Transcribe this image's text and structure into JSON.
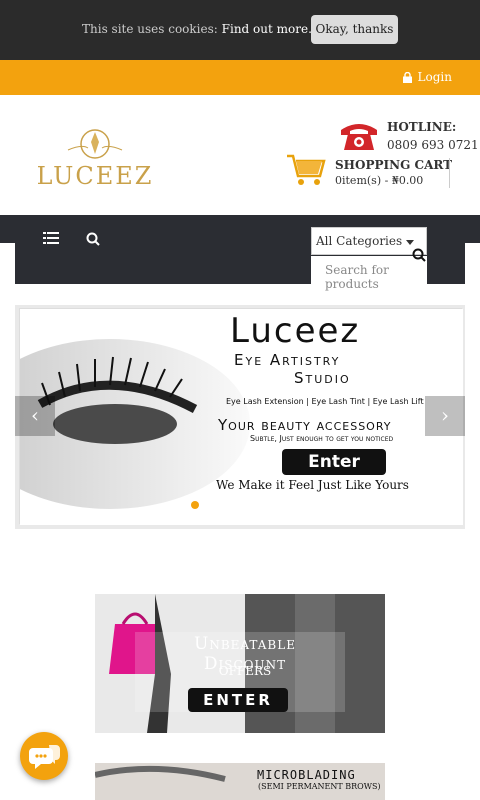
{
  "cookie": {
    "text": "This site uses cookies:",
    "link": "Find out more.",
    "button": "Okay, thanks"
  },
  "topbar": {
    "login": "Login"
  },
  "logo": {
    "text": "LUCEEZ"
  },
  "hotline": {
    "label": "HOTLINE:",
    "number": "0809 693 0721"
  },
  "cart": {
    "title": "SHOPPING CART",
    "summary": "0item(s) - ₦0.00"
  },
  "search": {
    "category": "All Categories",
    "placeholder": "Search for products"
  },
  "slider": {
    "brand": "Luceez",
    "line1": "Eye Artistry",
    "line2": "Studio",
    "services": [
      "Eye Lash Extension",
      "Eye Lash Tint",
      "Eye Lash Lift"
    ],
    "tagline": "Your beauty accessory",
    "subtitle": "Subtle, Just enough to get you noticed",
    "enter": "Enter",
    "footer": "We Make it Feel Just Like Yours"
  },
  "banner1": {
    "line1": "Unbeatable Discount",
    "line2": "offers",
    "enter": "ENTER"
  },
  "banner2": {
    "line1": "MICROBLADING",
    "line2": "(SEMI PERMANENT BROWS)"
  },
  "colors": {
    "accent": "#f3a20e",
    "dark": "#2b2d33"
  }
}
